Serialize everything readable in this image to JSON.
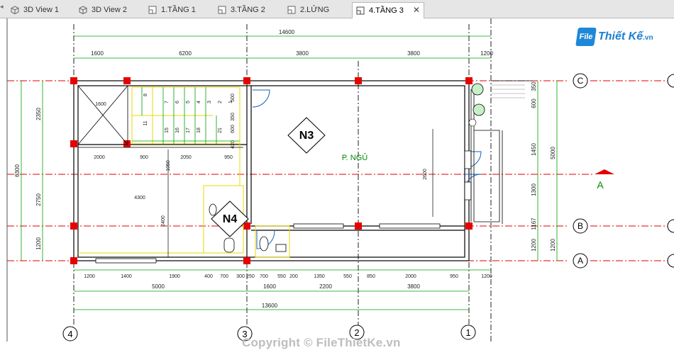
{
  "tabs": [
    {
      "label": "3D View 1",
      "icon": "3d-view-icon"
    },
    {
      "label": "3D View 2",
      "icon": "3d-view-icon"
    },
    {
      "label": "1.TẦNG 1",
      "icon": "floor-plan-icon"
    },
    {
      "label": "3.TẦNG 2",
      "icon": "floor-plan-icon"
    },
    {
      "label": "2.LỬNG",
      "icon": "floor-plan-icon"
    },
    {
      "label": "4.TẦNG 3",
      "icon": "floor-plan-icon",
      "active": true,
      "close": "✕"
    }
  ],
  "logo": {
    "mark": "File",
    "brand": "Thiết Kế",
    "suffix": ".vn"
  },
  "watermark": "Copyright © FileThietKe.vn",
  "drawing": {
    "room_tags": [
      "N3",
      "N4"
    ],
    "room_name": "P. NGỦ",
    "grid_letters": [
      "C",
      "B",
      "A"
    ],
    "grid_numbers": [
      "4",
      "3",
      "2",
      "1"
    ],
    "section_mark": "A",
    "dims_top_total": "14600",
    "dims_top": [
      "1600",
      "6200",
      "3800",
      "3800",
      "1200"
    ],
    "dims_bottom_row1": [
      "1200",
      "1400",
      "1900",
      "400",
      "700",
      "300",
      "250",
      "700",
      "550",
      "200",
      "1350",
      "550",
      "850",
      "2000",
      "950",
      "1200"
    ],
    "dims_bottom_row2": [
      "5000",
      "1600",
      "2200",
      "3800"
    ],
    "dims_bottom_total": "13600",
    "dims_left": [
      "2350",
      "2750",
      "1200"
    ],
    "dims_left_total": "6300",
    "dims_right_inner": [
      "350",
      "600",
      "1450",
      "1300",
      "1167"
    ],
    "dims_right_outer": [
      "5000",
      "1200"
    ],
    "dims_right_b_a": "1200",
    "dims_interior": [
      "2000",
      "900",
      "2050",
      "950",
      "1600",
      "1050",
      "2400",
      "4300",
      "2600",
      "500",
      "350",
      "600",
      "420"
    ],
    "stair_numbers": [
      "8",
      "7",
      "6",
      "5",
      "4",
      "3",
      "2",
      "1",
      "11",
      "15",
      "16",
      "17",
      "18",
      "21"
    ],
    "colors": {
      "wall": "#e60000",
      "dim": "#00a000",
      "grid": "#e00000",
      "yellow": "#e8d800",
      "blue": "#1060c0",
      "black": "#000000"
    }
  }
}
